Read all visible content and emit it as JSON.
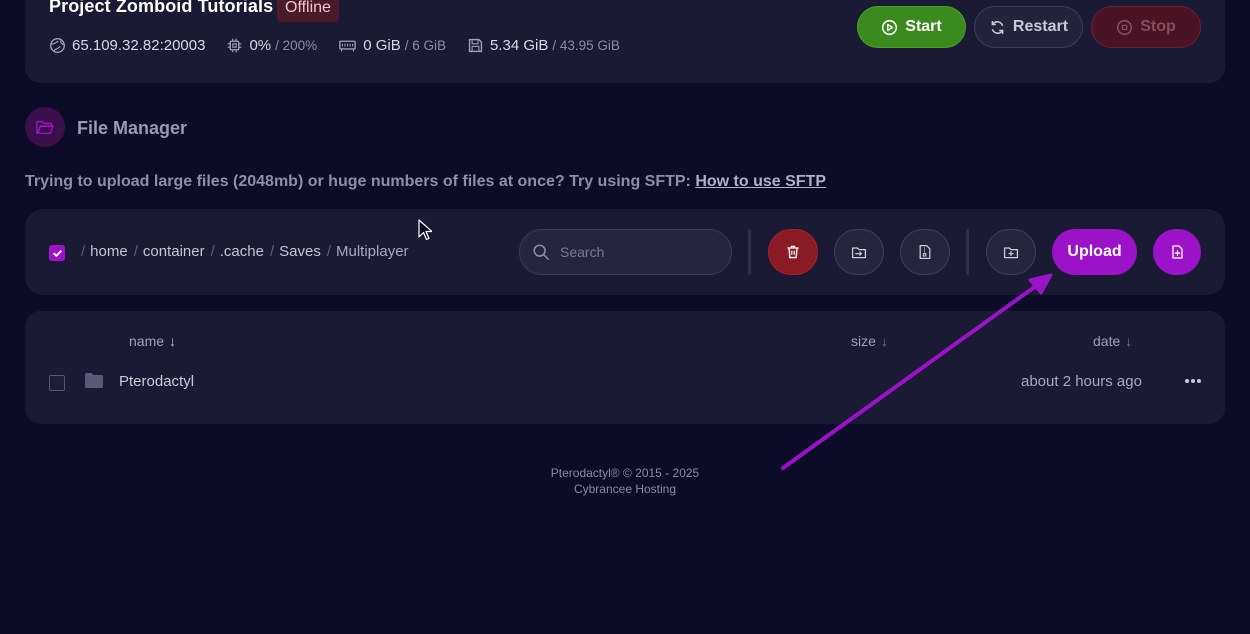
{
  "server": {
    "title": "Project Zomboid Tutorials",
    "status": "Offline",
    "address": "65.109.32.82:20003",
    "cpu_used": "0%",
    "cpu_limit": "/ 200%",
    "memory_used": "0 GiB",
    "memory_limit": "/ 6 GiB",
    "disk_used": "5.34 GiB",
    "disk_limit": "/ 43.95 GiB"
  },
  "power": {
    "start_label": "Start",
    "restart_label": "Restart",
    "stop_label": "Stop"
  },
  "file_manager": {
    "title": "File Manager",
    "sftp_note": "Trying to upload large files (2048mb) or huge numbers of files at once? Try using SFTP: ",
    "sftp_link": "How to use SFTP"
  },
  "breadcrumb": [
    "home",
    "container",
    ".cache",
    "Saves",
    "Multiplayer"
  ],
  "toolbar": {
    "search_placeholder": "Search",
    "upload_label": "Upload"
  },
  "columns": {
    "name": "name",
    "size": "size",
    "date": "date",
    "sort_arrow": "↓"
  },
  "files": [
    {
      "name": "Pterodactyl",
      "size": "",
      "date": "about 2 hours ago",
      "type": "folder"
    }
  ],
  "footer": {
    "line1": "Pterodactyl® © 2015 - 2025",
    "line2": "Cybrancee Hosting"
  },
  "colors": {
    "background": "#0c0c28",
    "card": "#1a1a35",
    "accent_purple": "#9b12c8",
    "start_green": "#3a8a1e",
    "stop_red": "#4b1426",
    "delete_red": "#8a1a24"
  }
}
